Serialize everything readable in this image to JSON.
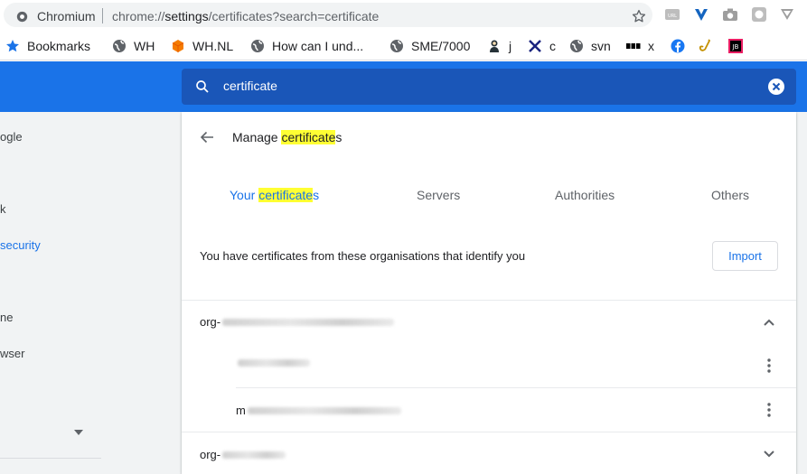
{
  "browser": {
    "site_name": "Chromium",
    "url_scheme": "chrome://",
    "url_host": "settings",
    "url_path": "/certificates?search=certificate",
    "extensions": [
      "ext-icon-1",
      "vivaldi-like-icon",
      "camera-icon",
      "ext-icon-4",
      "pocket-like-icon"
    ]
  },
  "bookmarks": [
    {
      "label": "Bookmarks",
      "icon": "star-icon"
    },
    {
      "label": "WH",
      "icon": "globe-icon"
    },
    {
      "label": "WH.NL",
      "icon": "cube-icon"
    },
    {
      "label": "How can I und...",
      "icon": "globe-icon"
    },
    {
      "label": "SME/7000",
      "icon": "globe-icon"
    },
    {
      "label": "j",
      "icon": "jenkins-icon"
    },
    {
      "label": "c",
      "icon": "tools-icon"
    },
    {
      "label": "svn",
      "icon": "globe-icon"
    },
    {
      "label": "x",
      "icon": "bbc-icon"
    },
    {
      "label": "",
      "icon": "facebook-icon"
    },
    {
      "label": "",
      "icon": "sax-icon"
    },
    {
      "label": "",
      "icon": "jb-icon"
    }
  ],
  "search": {
    "value": "certificate"
  },
  "sidebar": {
    "items": [
      {
        "label": "ogle"
      },
      {
        "label": "k"
      },
      {
        "label": "security"
      },
      {
        "label": "ne"
      },
      {
        "label": "wser"
      }
    ]
  },
  "card": {
    "title_pre": "Manage ",
    "title_mark": "certificate",
    "title_post": "s",
    "tabs": [
      {
        "pre": "Your ",
        "mark": "certificate",
        "post": "s"
      },
      {
        "label": "Servers"
      },
      {
        "label": "Authorities"
      },
      {
        "label": "Others"
      }
    ],
    "description": "You have certificates from these organisations that identify you",
    "import_label": "Import",
    "orgs": [
      {
        "prefix": "org-"
      },
      {
        "prefix": "org-"
      }
    ],
    "cert_prefix_1": "",
    "cert_prefix_2": "m"
  },
  "colors": {
    "accent": "#1a73e8",
    "header": "#1a73e8",
    "search_bg": "#1a56b8",
    "highlight": "#ffff33"
  }
}
